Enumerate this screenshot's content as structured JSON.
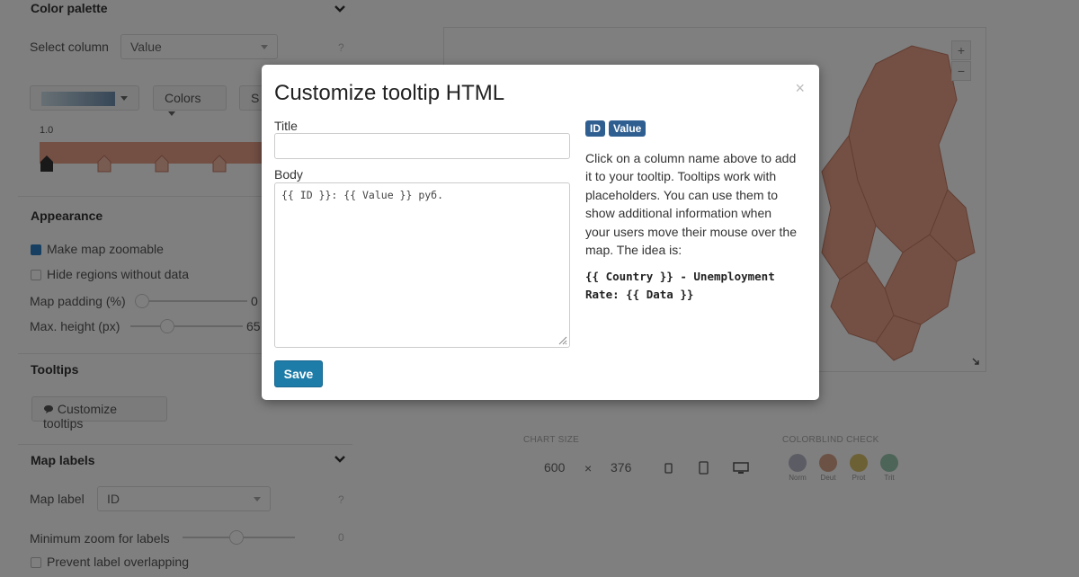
{
  "sidebar": {
    "color_palette": {
      "heading": "Color palette",
      "select_column_label": "Select column",
      "select_column_value": "Value",
      "help": "?",
      "colors_button": "Colors",
      "partial_button": "S",
      "stop_value": "1.0"
    },
    "appearance": {
      "heading": "Appearance",
      "zoomable_label": "Make map zoomable",
      "zoomable_checked": true,
      "hide_regions_label": "Hide regions without data",
      "hide_regions_checked": false,
      "padding_label": "Map padding (%)",
      "padding_value": "0",
      "max_height_label": "Max. height (px)",
      "max_height_value": "65"
    },
    "tooltips": {
      "heading": "Tooltips",
      "customize_button": "Customize tooltips"
    },
    "map_labels": {
      "heading": "Map labels",
      "map_label_label": "Map label",
      "map_label_value": "ID",
      "help": "?",
      "min_zoom_label": "Minimum zoom for labels",
      "min_zoom_value": "0",
      "prevent_overlap_label": "Prevent label overlapping"
    }
  },
  "preview": {
    "zoom_in": "+",
    "zoom_out": "−",
    "chart_size_label": "CHART SIZE",
    "width": "600",
    "times": "×",
    "height": "376",
    "colorblind_label": "COLORBLIND CHECK",
    "colorblind_modes": [
      "Norm",
      "Deut",
      "Prot",
      "Trit"
    ],
    "colorblind_colors": [
      "#b9b9c8",
      "#d9a58a",
      "#d8c06a",
      "#9ac9b0"
    ]
  },
  "modal": {
    "title": "Customize tooltip HTML",
    "close": "×",
    "title_label": "Title",
    "title_value": "",
    "body_label": "Body",
    "body_value": "{{ ID }}: {{ Value }} руб.",
    "save_label": "Save",
    "column_badges": [
      "ID",
      "Value"
    ],
    "help_text": "Click on a column name above to add it to your tooltip. Tooltips work with placeholders. You can use them to show additional information when your users move their mouse over the map. The idea is:",
    "example": "{{ Country }} - Unemployment Rate: {{ Data }}"
  },
  "colors": {
    "accent": "#1d7ca8",
    "badge": "#2f5f91",
    "map_fill": "#e8a089",
    "map_stroke": "#c47b65"
  }
}
